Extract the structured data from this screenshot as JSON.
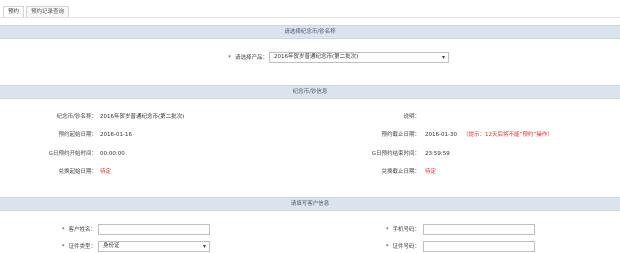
{
  "tabs": [
    {
      "label": "预约",
      "active": true
    },
    {
      "label": "预约记录查询",
      "active": false
    }
  ],
  "section_product": {
    "title": "请选择纪念币/钞名称",
    "field_label": "请选择产品：",
    "selected": "2016年贺岁普通纪念币(第二批次)"
  },
  "section_info": {
    "title": "纪念币/钞信息",
    "name_label": "纪念币/钞名称：",
    "name_value": "2016年贺岁普通纪念币(第二批次)",
    "desc_label": "说明：",
    "desc_value": "",
    "start_date_label": "预约起始日期：",
    "start_date_value": "2016-01-16",
    "end_date_label": "预约截止日期：",
    "end_date_value": "2016-01-30",
    "end_date_note": "（提示：12天后将不能“预约”操作）",
    "day_start_label": "G日预约开始时间：",
    "day_start_value": "00:00:00",
    "day_end_label": "G日预约结束时间：",
    "day_end_value": "23:59:59",
    "exchange_start_label": "兑换起始日期：",
    "exchange_start_value": "待定",
    "exchange_end_label": "兑换截止日期：",
    "exchange_end_value": "待定"
  },
  "section_customer": {
    "title": "请填写客户信息",
    "customer_name_label": "客户姓名：",
    "customer_name_value": "",
    "phone_label": "手机号码：",
    "phone_value": "",
    "id_type_label": "证件类型：",
    "id_type_selected": "身份证",
    "id_number_label": "证件号码：",
    "id_number_value": ""
  },
  "colors": {
    "section_bar": "#dbe4ee",
    "highlight_red": "#e62b2b"
  },
  "icons": {
    "dropdown": "chevron-down-icon"
  }
}
